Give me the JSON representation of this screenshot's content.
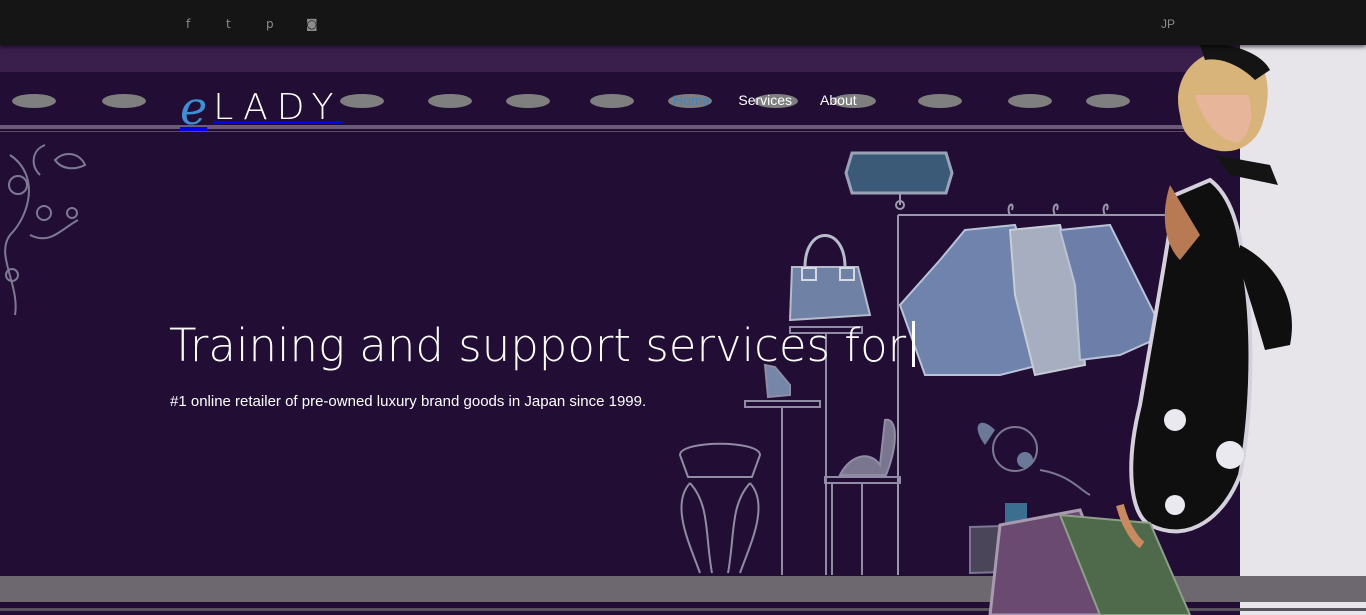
{
  "topbar": {
    "social": [
      {
        "name": "facebook",
        "glyph": "f"
      },
      {
        "name": "twitter",
        "glyph": "t"
      },
      {
        "name": "pinterest",
        "glyph": "p"
      },
      {
        "name": "instagram",
        "glyph": "◙"
      }
    ],
    "language": "JP"
  },
  "brand": {
    "logo_initial": "e",
    "logo_text": "LADY"
  },
  "nav": {
    "items": [
      {
        "label": "Home",
        "active": true
      },
      {
        "label": "Services",
        "active": false
      },
      {
        "label": "About",
        "active": false
      }
    ]
  },
  "hero": {
    "headline": "Training and support services for",
    "subtitle": "#1 online retailer of pre-owned luxury brand goods in Japan since 1999."
  },
  "colors": {
    "topbar_bg": "#151515",
    "hero_bg": "#220e34",
    "accent": "#3d86c9",
    "text": "#ffffff"
  }
}
